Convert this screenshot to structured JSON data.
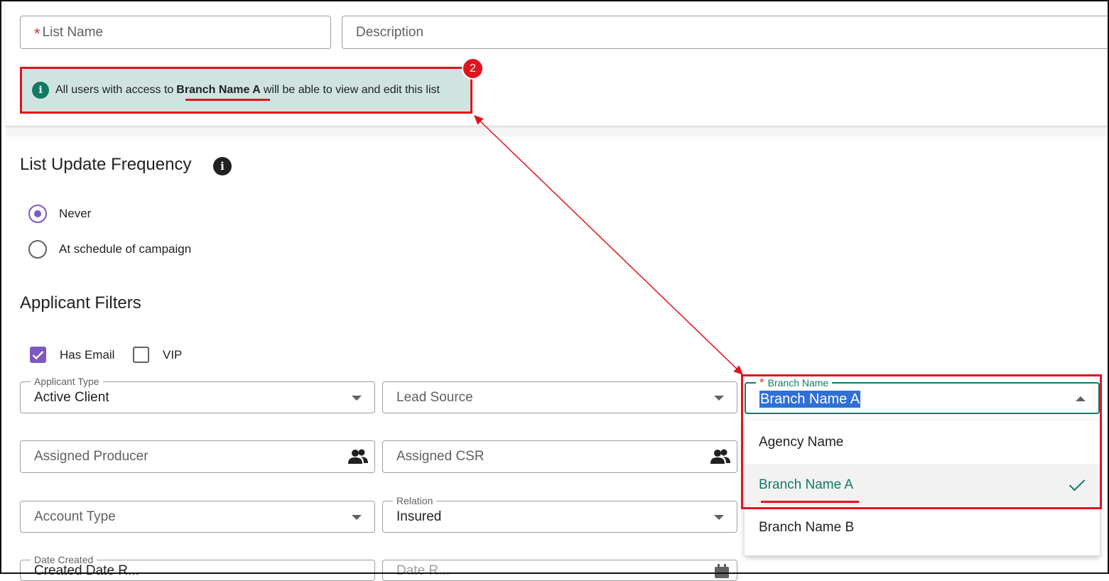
{
  "form": {
    "list_name_placeholder": "List Name",
    "description_placeholder": "Description"
  },
  "banner": {
    "prefix": "All users with access to",
    "branch": "Branch Name A",
    "suffix": "will be able to view and edit this list",
    "icon": "info-icon"
  },
  "annotation": {
    "badge": "2"
  },
  "frequency": {
    "title": "List Update Frequency",
    "options": [
      {
        "label": "Never",
        "checked": true
      },
      {
        "label": "At schedule of campaign",
        "checked": false
      }
    ]
  },
  "filters": {
    "title": "Applicant Filters",
    "has_email_label": "Has Email",
    "vip_label": "VIP",
    "applicant_type": {
      "label": "Applicant Type",
      "value": "Active Client"
    },
    "lead_source_placeholder": "Lead Source",
    "assigned_producer_placeholder": "Assigned Producer",
    "assigned_csr_placeholder": "Assigned CSR",
    "account_type_placeholder": "Account Type",
    "relation": {
      "label": "Relation",
      "value": "Insured"
    },
    "date_created": {
      "label": "Date Created",
      "value": "Created Date R..."
    },
    "date_r_placeholder": "Date R..."
  },
  "branch": {
    "label": "Branch Name",
    "value": "Branch Name A",
    "options": [
      "Agency Name",
      "Branch Name A",
      "Branch Name B"
    ],
    "selected_index": 1
  },
  "colors": {
    "accent_teal": "#117a65",
    "purple": "#7e57c2",
    "annotation_red": "#e0141e",
    "banner_bg": "#cfe4e0"
  }
}
